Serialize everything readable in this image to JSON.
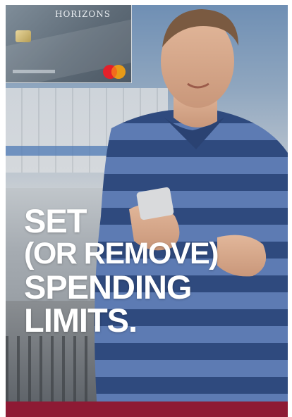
{
  "card": {
    "brand": "HORIZONS",
    "network_icon": "mastercard-logo"
  },
  "headline": {
    "line1": "SET",
    "line2": "(OR REMOVE)",
    "line3": "SPENDING",
    "line4": "LIMITS."
  },
  "colors": {
    "footer_bar": "#8e1a34",
    "headline_text": "#ffffff",
    "shirt_stripe_dark": "#2f4a7e",
    "shirt_stripe_light": "#5d7bb3"
  }
}
